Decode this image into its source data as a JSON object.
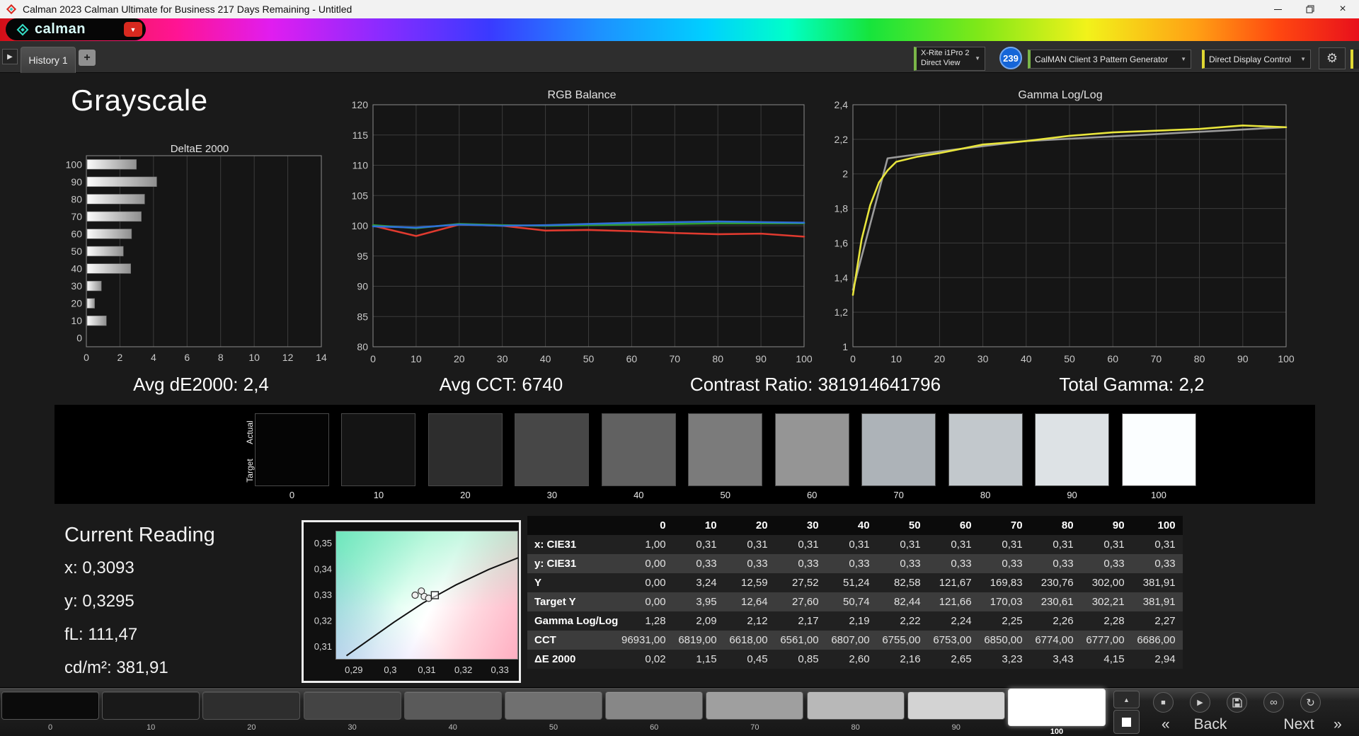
{
  "colors": {
    "accent_green": "#7ab648",
    "accent_yellow": "#e0d832",
    "brand_red": "#d8291f",
    "badge_blue": "#1565d8",
    "logo_teal": "#35e0c8"
  },
  "icons": {
    "dropdown": "▼",
    "logo_arrow": "▼",
    "forward": "▶",
    "gear": "⚙",
    "close": "×",
    "caret_up": "▲",
    "stop": "■",
    "play": "▶",
    "infinity": "∞",
    "refresh": "↻",
    "plus": "+"
  },
  "title_bar": {
    "title": "Calman 2023 Calman Ultimate for Business 217 Days Remaining  - Untitled"
  },
  "brand": {
    "name": "calman"
  },
  "tabs": {
    "history": "History 1"
  },
  "devices": {
    "meter_line1": "X-Rite i1Pro 2",
    "meter_line2": "Direct View",
    "badge": "239",
    "pattern_generator": "CalMAN Client 3 Pattern Generator",
    "display_control": "Direct Display Control"
  },
  "page": {
    "title": "Grayscale"
  },
  "summary": {
    "avg_de": "Avg dE2000: 2,4",
    "avg_cct": "Avg CCT: 6740",
    "contrast": "Contrast Ratio: 381914641796",
    "total_gamma": "Total Gamma: 2,2"
  },
  "current_reading": {
    "heading": "Current Reading",
    "x": "x: 0,3093",
    "y": "y: 0,3295",
    "fl": "fL: 111,47",
    "cdm2": "cd/m²: 381,91"
  },
  "ramp": {
    "row_labels": [
      "Actual",
      "Target"
    ],
    "steps": [
      {
        "label": "0",
        "color": "#050505"
      },
      {
        "label": "10",
        "color": "#141414"
      },
      {
        "label": "20",
        "color": "#2d2d2d"
      },
      {
        "label": "30",
        "color": "#474747"
      },
      {
        "label": "40",
        "color": "#616161"
      },
      {
        "label": "50",
        "color": "#7b7b7b"
      },
      {
        "label": "60",
        "color": "#959595"
      },
      {
        "label": "70",
        "color": "#adb3b8"
      },
      {
        "label": "80",
        "color": "#c2c8cc"
      },
      {
        "label": "90",
        "color": "#dde2e5"
      },
      {
        "label": "100",
        "color": "#fbfeff"
      }
    ]
  },
  "table": {
    "columns": [
      "",
      "0",
      "10",
      "20",
      "30",
      "40",
      "50",
      "60",
      "70",
      "80",
      "90",
      "100"
    ],
    "rows": [
      {
        "label": "x: CIE31",
        "values": [
          "1,00",
          "0,31",
          "0,31",
          "0,31",
          "0,31",
          "0,31",
          "0,31",
          "0,31",
          "0,31",
          "0,31",
          "0,31"
        ]
      },
      {
        "label": "y: CIE31",
        "values": [
          "0,00",
          "0,33",
          "0,33",
          "0,33",
          "0,33",
          "0,33",
          "0,33",
          "0,33",
          "0,33",
          "0,33",
          "0,33"
        ]
      },
      {
        "label": "Y",
        "values": [
          "0,00",
          "3,24",
          "12,59",
          "27,52",
          "51,24",
          "82,58",
          "121,67",
          "169,83",
          "230,76",
          "302,00",
          "381,91"
        ]
      },
      {
        "label": "Target Y",
        "values": [
          "0,00",
          "3,95",
          "12,64",
          "27,60",
          "50,74",
          "82,44",
          "121,66",
          "170,03",
          "230,61",
          "302,21",
          "381,91"
        ]
      },
      {
        "label": "Gamma Log/Log",
        "values": [
          "1,28",
          "2,09",
          "2,12",
          "2,17",
          "2,19",
          "2,22",
          "2,24",
          "2,25",
          "2,26",
          "2,28",
          "2,27"
        ]
      },
      {
        "label": "CCT",
        "values": [
          "96931,00",
          "6819,00",
          "6618,00",
          "6561,00",
          "6807,00",
          "6755,00",
          "6753,00",
          "6850,00",
          "6774,00",
          "6777,00",
          "6686,00"
        ]
      },
      {
        "label": "ΔE 2000",
        "values": [
          "0,02",
          "1,15",
          "0,45",
          "0,85",
          "2,60",
          "2,16",
          "2,65",
          "3,23",
          "3,43",
          "4,15",
          "2,94"
        ]
      }
    ]
  },
  "chart_data": [
    {
      "id": "deltae",
      "type": "bar",
      "orientation": "horizontal",
      "title": "DeltaE 2000",
      "categories": [
        "100",
        "90",
        "80",
        "70",
        "60",
        "50",
        "40",
        "30",
        "20",
        "10",
        "0"
      ],
      "values": [
        2.94,
        4.15,
        3.43,
        3.23,
        2.65,
        2.16,
        2.6,
        0.85,
        0.45,
        1.15,
        0.02
      ],
      "xlim": [
        0,
        14
      ],
      "xticks": [
        0,
        2,
        4,
        6,
        8,
        10,
        12,
        14
      ],
      "xticklabels": [
        "0",
        "2",
        "4",
        "6",
        "8",
        "10",
        "12",
        "14"
      ],
      "grid": true
    },
    {
      "id": "rgb-balance",
      "type": "line",
      "title": "RGB Balance",
      "x": [
        0,
        10,
        20,
        30,
        40,
        50,
        60,
        70,
        80,
        90,
        100
      ],
      "xlim": [
        0,
        100
      ],
      "xticks": [
        0,
        10,
        20,
        30,
        40,
        50,
        60,
        70,
        80,
        90,
        100
      ],
      "xticklabels": [
        "0",
        "10",
        "20",
        "30",
        "40",
        "50",
        "60",
        "70",
        "80",
        "90",
        "100"
      ],
      "ylim": [
        80,
        120
      ],
      "yticks": [
        80,
        85,
        90,
        95,
        100,
        105,
        110,
        115,
        120
      ],
      "yticklabels": [
        "80",
        "85",
        "90",
        "95",
        "100",
        "105",
        "110",
        "115",
        "120"
      ],
      "grid": true,
      "series": [
        {
          "name": "red",
          "color": "#e03a2f",
          "values": [
            100.0,
            98.3,
            100.2,
            100.0,
            99.2,
            99.3,
            99.1,
            98.8,
            98.6,
            98.7,
            98.2
          ]
        },
        {
          "name": "green",
          "color": "#2f9e33",
          "values": [
            100.1,
            99.6,
            100.3,
            100.1,
            100.0,
            100.1,
            100.2,
            100.3,
            100.4,
            100.4,
            100.4
          ]
        },
        {
          "name": "blue",
          "color": "#2f6fd8",
          "values": [
            99.9,
            99.7,
            100.2,
            100.0,
            100.1,
            100.3,
            100.5,
            100.6,
            100.7,
            100.6,
            100.5
          ]
        }
      ]
    },
    {
      "id": "gamma",
      "type": "line",
      "title": "Gamma Log/Log",
      "xlim": [
        0,
        100
      ],
      "xticks": [
        0,
        10,
        20,
        30,
        40,
        50,
        60,
        70,
        80,
        90,
        100
      ],
      "xticklabels": [
        "0",
        "10",
        "20",
        "30",
        "40",
        "50",
        "60",
        "70",
        "80",
        "90",
        "100"
      ],
      "ylim": [
        1,
        2.4
      ],
      "yticks": [
        1,
        1.2,
        1.4,
        1.6,
        1.8,
        2,
        2.2,
        2.4
      ],
      "yticklabels": [
        "1",
        "1,2",
        "1,4",
        "1,6",
        "1,8",
        "2",
        "2,2",
        "2,4"
      ],
      "grid": true,
      "series": [
        {
          "name": "target",
          "color": "#9b9b9b",
          "x": [
            0,
            8,
            20,
            40,
            100
          ],
          "values": [
            1.33,
            2.09,
            2.13,
            2.19,
            2.27
          ]
        },
        {
          "name": "measured",
          "color": "#e8e53c",
          "x": [
            0,
            2,
            4,
            6,
            8,
            10,
            15,
            20,
            30,
            40,
            50,
            60,
            70,
            80,
            90,
            100
          ],
          "values": [
            1.3,
            1.62,
            1.82,
            1.95,
            2.02,
            2.07,
            2.1,
            2.12,
            2.17,
            2.19,
            2.22,
            2.24,
            2.25,
            2.26,
            2.28,
            2.27
          ]
        }
      ]
    },
    {
      "id": "cie",
      "type": "scatter",
      "title": "CIE chromaticity (white point)",
      "xlim": [
        0.285,
        0.335
      ],
      "ylim": [
        0.305,
        0.355
      ],
      "xticks": [
        0.29,
        0.3,
        0.31,
        0.32,
        0.33
      ],
      "xticklabels": [
        "0,29",
        "0,3",
        "0,31",
        "0,32",
        "0,33"
      ],
      "yticks": [
        0.31,
        0.32,
        0.33,
        0.34,
        0.35
      ],
      "yticklabels": [
        "0,31",
        "0,32",
        "0,33",
        "0,34",
        "0,35"
      ],
      "locus": [
        [
          0.288,
          0.3065
        ],
        [
          0.294,
          0.3125
        ],
        [
          0.301,
          0.3195
        ],
        [
          0.309,
          0.327
        ],
        [
          0.318,
          0.334
        ],
        [
          0.327,
          0.34
        ],
        [
          0.335,
          0.3445
        ]
      ],
      "measured": [
        [
          0.3068,
          0.33
        ],
        [
          0.3085,
          0.3316
        ],
        [
          0.3093,
          0.3295
        ],
        [
          0.3105,
          0.3288
        ]
      ],
      "target": [
        [
          0.3122,
          0.33
        ]
      ]
    }
  ],
  "bottom_bar": {
    "patches": [
      {
        "label": "0",
        "color": "#0b0b0b"
      },
      {
        "label": "10",
        "color": "#191919"
      },
      {
        "label": "20",
        "color": "#2e2e2e"
      },
      {
        "label": "30",
        "color": "#444444"
      },
      {
        "label": "40",
        "color": "#5a5a5a"
      },
      {
        "label": "50",
        "color": "#707070"
      },
      {
        "label": "60",
        "color": "#878787"
      },
      {
        "label": "70",
        "color": "#9f9f9f"
      },
      {
        "label": "80",
        "color": "#b8b8b8"
      },
      {
        "label": "90",
        "color": "#d3d3d3"
      },
      {
        "label": "100",
        "color": "#ffffff"
      }
    ],
    "selected_index": 10,
    "back": "Back",
    "next": "Next",
    "back_chevron": "«",
    "next_chevron": "»"
  }
}
